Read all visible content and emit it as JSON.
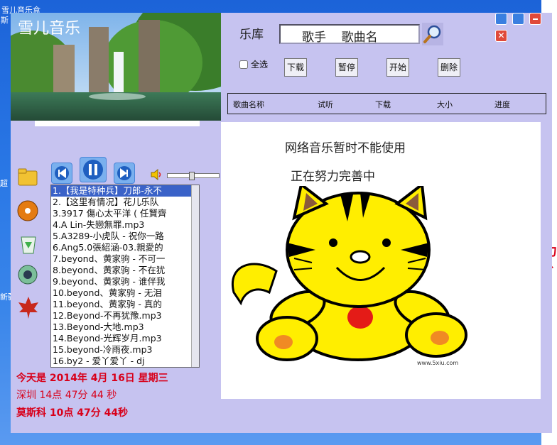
{
  "desktop": {
    "top_label": "雪儿音乐盒",
    "labels": [
      "斯",
      "超",
      "新疆"
    ],
    "right_marks": [
      "力",
      "丶"
    ]
  },
  "app": {
    "title": "雪儿音乐",
    "library_label": "乐库",
    "search": {
      "value": "歌手    歌曲名"
    },
    "select_all_label": "全选",
    "buttons": {
      "download": "下载",
      "pause": "暂停",
      "start": "开始",
      "delete": "删除"
    },
    "table_headers": [
      "歌曲名称",
      "试听",
      "下载",
      "大小",
      "进度"
    ],
    "network": {
      "message1": "网络音乐暂时不能使用",
      "message2": "正在努力完善中",
      "watermark": "www.5xiu.com"
    },
    "playlist": [
      "1.【我是特种兵】刀郎-永不",
      "2.【这里有情况】花儿乐队",
      "3.3917 傷心太平洋 ( 任賢齊",
      "4.A Lin-失戀無罪.mp3",
      "5.A3289-小虎队 - 祝你一路",
      "6.Ang5.0張紹涵-03.親愛的",
      "7.beyond、黄家驹 - 不可一",
      "8.beyond、黄家驹 - 不在犹",
      "9.beyond、黄家驹 - 谁伴我",
      "10.beyond、黄家驹 - 无泪",
      "11.beyond、黄家驹 - 真的",
      "12.Beyond-不再犹豫.mp3",
      "13.Beyond-大地.mp3",
      "14.Beyond-光辉岁月.mp3",
      "15.beyond-冷雨夜.mp3",
      "16.by2 - 爱丫爱丫 - dj"
    ],
    "selected_index": 0,
    "date_line": "今天是  2014年  4月  16日  星期三",
    "shenzhen_time": "深圳  14点  47分  44  秒",
    "moscow_time": "莫斯科  10点  47分  44秒",
    "colors": {
      "window_bg": "#c6c3f0",
      "accent_red": "#d8001a"
    }
  }
}
